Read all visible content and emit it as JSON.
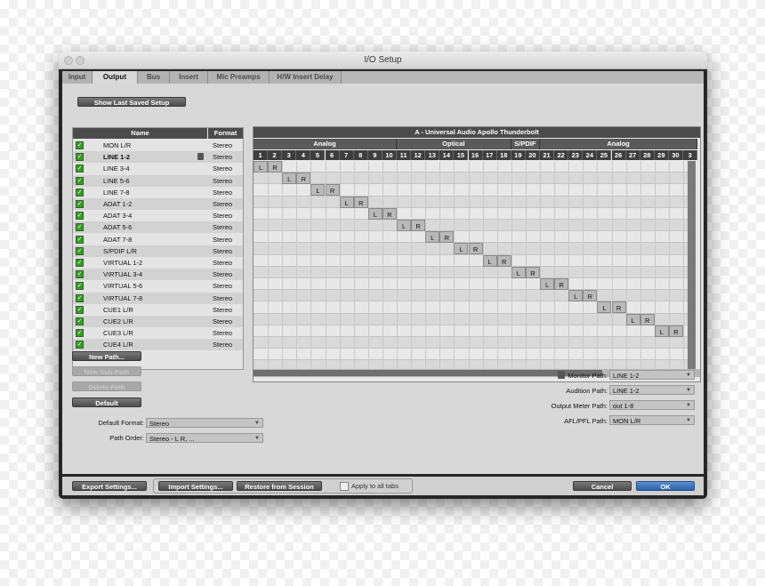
{
  "window": {
    "title": "I/O Setup"
  },
  "tabs": [
    {
      "label": "Input",
      "active": false
    },
    {
      "label": "Output",
      "active": true
    },
    {
      "label": "Bus",
      "active": false
    },
    {
      "label": "Insert",
      "active": false
    },
    {
      "label": "Mic Preamps",
      "active": false
    },
    {
      "label": "H/W Insert Delay",
      "active": false
    }
  ],
  "toolbar": {
    "show_last_saved": "Show Last Saved Setup"
  },
  "list": {
    "name_header": "Name",
    "format_header": "Format",
    "rows": [
      {
        "name": "MON L/R",
        "format": "Stereo",
        "bold": false
      },
      {
        "name": "LINE 1-2",
        "format": "Stereo",
        "bold": true
      },
      {
        "name": "LINE 3-4",
        "format": "Stereo",
        "bold": false
      },
      {
        "name": "LINE 5-6",
        "format": "Stereo",
        "bold": false
      },
      {
        "name": "LINE 7-8",
        "format": "Stereo",
        "bold": false
      },
      {
        "name": "ADAT 1-2",
        "format": "Stereo",
        "bold": false
      },
      {
        "name": "ADAT 3-4",
        "format": "Stereo",
        "bold": false
      },
      {
        "name": "ADAT 5-6",
        "format": "Stereo",
        "bold": false
      },
      {
        "name": "ADAT 7-8",
        "format": "Stereo",
        "bold": false
      },
      {
        "name": "S/PDIF L/R",
        "format": "Stereo",
        "bold": false
      },
      {
        "name": "VIRTUAL 1-2",
        "format": "Stereo",
        "bold": false
      },
      {
        "name": "VIRTUAL 3-4",
        "format": "Stereo",
        "bold": false
      },
      {
        "name": "VIRTUAL 5-6",
        "format": "Stereo",
        "bold": false
      },
      {
        "name": "VIRTUAL 7-8",
        "format": "Stereo",
        "bold": false
      },
      {
        "name": "CUE1 L/R",
        "format": "Stereo",
        "bold": false
      },
      {
        "name": "CUE2 L/R",
        "format": "Stereo",
        "bold": false
      },
      {
        "name": "CUE3 L/R",
        "format": "Stereo",
        "bold": false
      },
      {
        "name": "CUE4 L/R",
        "format": "Stereo",
        "bold": false
      }
    ]
  },
  "grid": {
    "device": "A - Universal Audio Apollo Thunderbolt",
    "groups": [
      {
        "label": "Analog",
        "channels": 10
      },
      {
        "label": "Optical",
        "channels": 8
      },
      {
        "label": "S/PDIF",
        "channels": 2
      },
      {
        "label": "Analog",
        "channels": 11
      }
    ],
    "channels": [
      "1",
      "2",
      "3",
      "4",
      "5",
      "6",
      "7",
      "8",
      "9",
      "10",
      "11",
      "12",
      "13",
      "14",
      "15",
      "16",
      "17",
      "18",
      "19",
      "20",
      "21",
      "22",
      "23",
      "24",
      "25",
      "26",
      "27",
      "28",
      "29",
      "30",
      "3"
    ],
    "left_tag": "L",
    "right_tag": "R"
  },
  "path_buttons": {
    "new_path": "New Path...",
    "new_sub_path": "New Sub-Path",
    "delete_path": "Delete Path",
    "default": "Default"
  },
  "defaults": {
    "format_label": "Default Format:",
    "format_value": "Stereo",
    "order_label": "Path Order:",
    "order_value": "Stereo - L R, ..."
  },
  "paths": {
    "monitor_label": "Monitor Path:",
    "monitor_value": "LINE 1-2",
    "audition_label": "Audition Path:",
    "audition_value": "LINE 1-2",
    "meter_label": "Output Meter Path:",
    "meter_value": "out 1-8",
    "afl_label": "AFL/PFL Path:",
    "afl_value": "MON L/R"
  },
  "footer": {
    "export": "Export Settings...",
    "import": "Import Settings...",
    "restore": "Restore from Session",
    "apply_all": "Apply to all tabs",
    "cancel": "Cancel",
    "ok": "OK"
  },
  "colors": {
    "accent": "#2f62a8",
    "check": "#3a9a2a"
  }
}
